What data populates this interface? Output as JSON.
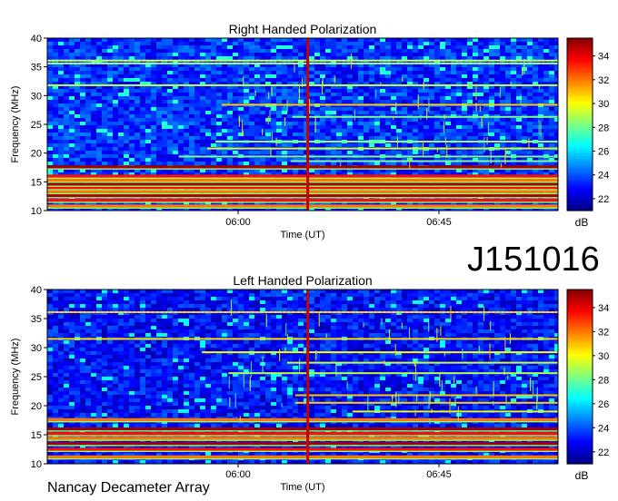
{
  "identifier": "J151016",
  "footer": "Nancay Decameter Array",
  "chart_data": [
    {
      "type": "heatmap",
      "title": "Right Handed Polarization",
      "xlabel": "Time (UT)",
      "ylabel": "Frequency (MHz)",
      "x_ticks": [
        "06:00",
        "06:45"
      ],
      "y_ticks": [
        10,
        15,
        20,
        25,
        30,
        35,
        40
      ],
      "ylim": [
        10,
        40
      ],
      "colorbar": {
        "label": "dB",
        "ticks": [
          22,
          24,
          26,
          28,
          30,
          32,
          34
        ],
        "range": [
          21,
          35.5
        ]
      },
      "features": {
        "background_db": 23.5,
        "persistent_bands_mhz": [
          10.8,
          11.8,
          12.6,
          13.3,
          14.0,
          14.6,
          15.3,
          16.0,
          17.6
        ],
        "moderate_bands_mhz": [
          36.1,
          35.6,
          31.8,
          28.4,
          26.3,
          22.0,
          20.8,
          19.4,
          18.6
        ],
        "vertical_burst_fraction": 0.51
      }
    },
    {
      "type": "heatmap",
      "title": "Left Handed Polarization",
      "xlabel": "Time (UT)",
      "ylabel": "Frequency (MHz)",
      "x_ticks": [
        "06:00",
        "06:45"
      ],
      "y_ticks": [
        10,
        15,
        20,
        25,
        30,
        35,
        40
      ],
      "ylim": [
        10,
        40
      ],
      "colorbar": {
        "label": "dB",
        "ticks": [
          22,
          24,
          26,
          28,
          30,
          32,
          34
        ],
        "range": [
          21,
          35.5
        ]
      },
      "features": {
        "background_db": 23.0,
        "persistent_bands_mhz": [
          11.2,
          12.5,
          13.5,
          14.4,
          15.2,
          16.0,
          17.6
        ],
        "moderate_bands_mhz": [
          36.1,
          31.5,
          29.2,
          27.4,
          25.6,
          21.8,
          20.5,
          19.0
        ],
        "vertical_burst_fraction": 0.51
      }
    }
  ]
}
